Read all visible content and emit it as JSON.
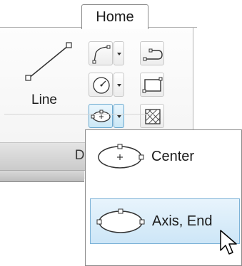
{
  "ribbon": {
    "tab_home": "Home",
    "panel_title": "Dra",
    "line_label": "Line"
  },
  "icons": {
    "polyline": "polyline-icon",
    "circle": "circle-icon",
    "ellipse": "ellipse-icon",
    "spline": "spline-icon",
    "rectangle": "rectangle-icon",
    "hatch": "hatch-icon"
  },
  "ellipse_menu": {
    "items": [
      {
        "label": "Center",
        "icon": "ellipse-center-icon"
      },
      {
        "label": "Axis, End",
        "icon": "ellipse-axis-end-icon"
      }
    ],
    "hovered_item": "Axis, End"
  },
  "colors": {
    "hover_fill": "#cde6f7",
    "hover_border": "#7db3d8"
  }
}
